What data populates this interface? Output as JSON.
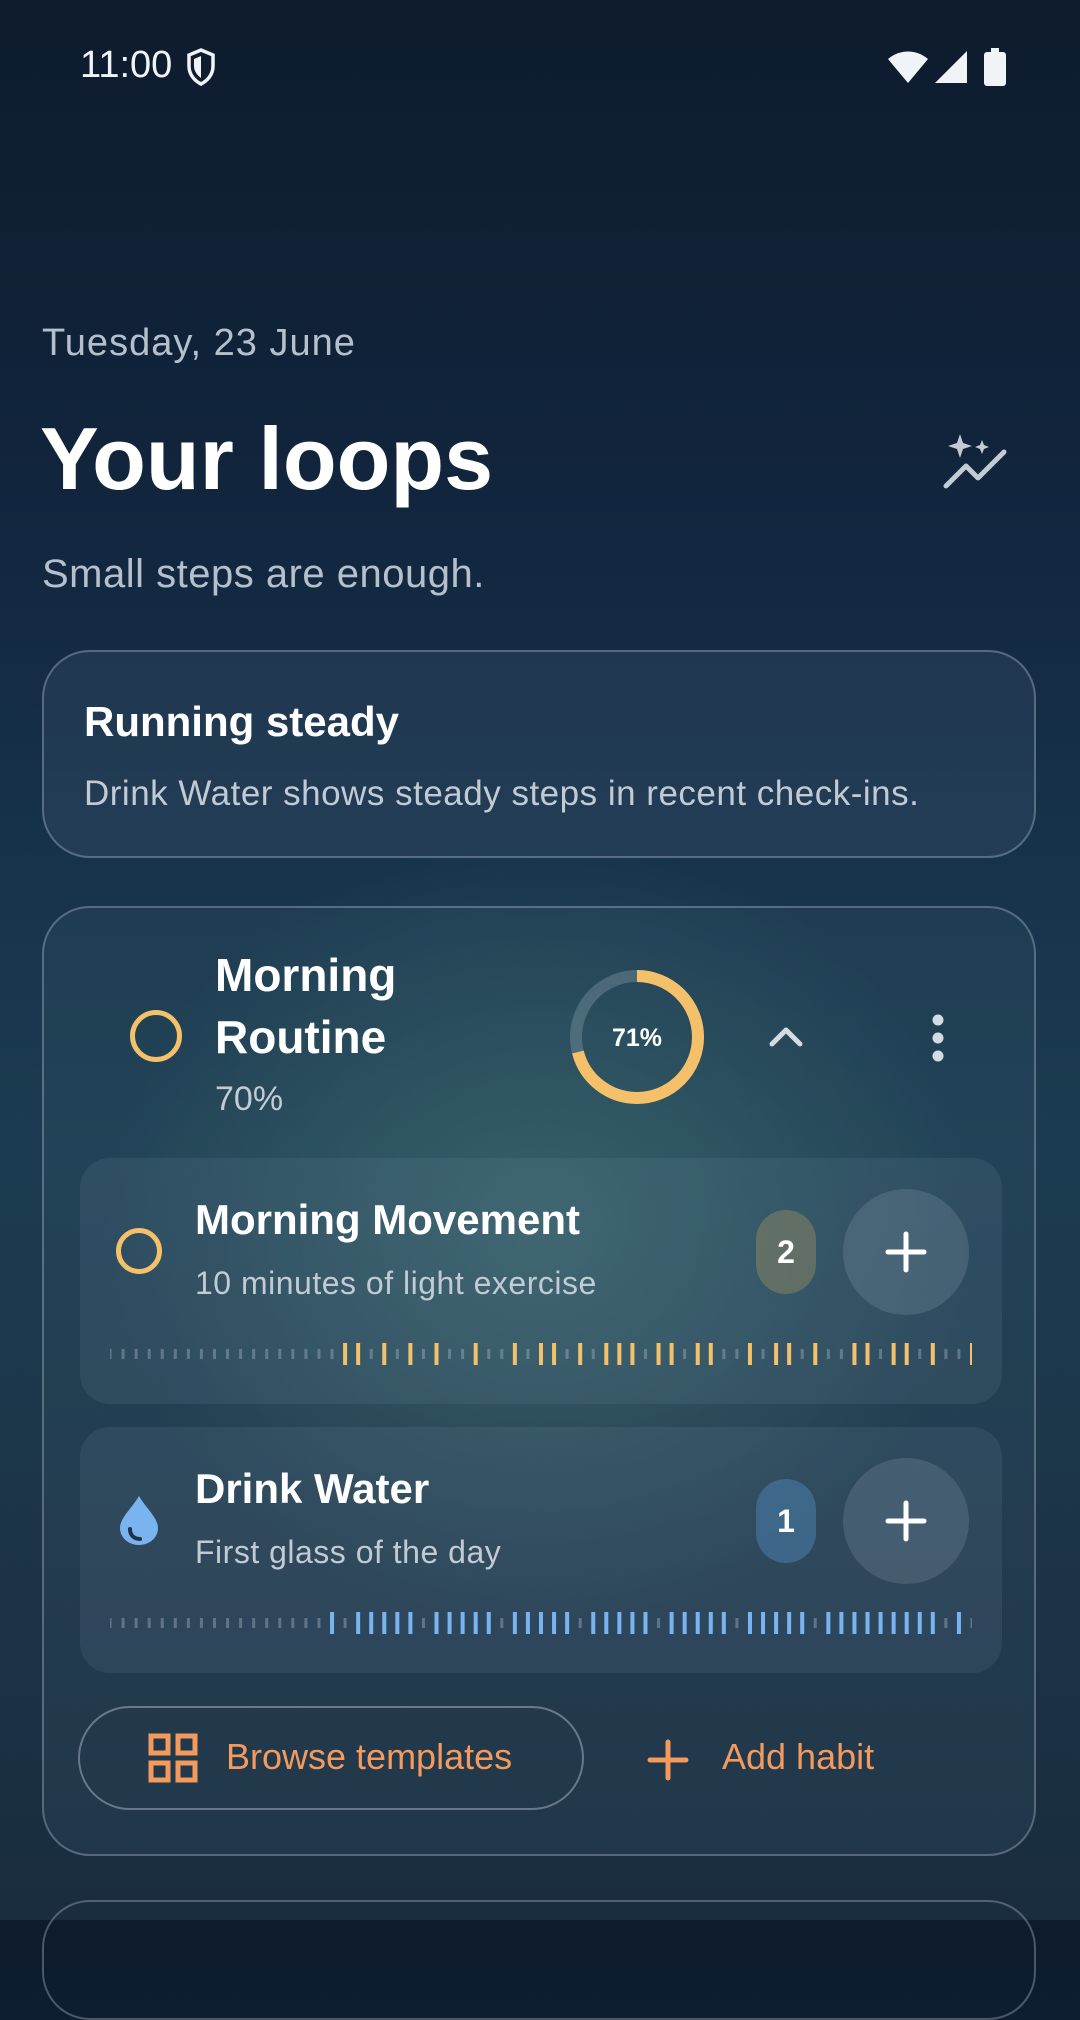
{
  "status_bar": {
    "time": "11:00"
  },
  "header": {
    "date": "Tuesday, 23 June",
    "title": "Your loops",
    "subtitle": "Small steps are enough."
  },
  "banner": {
    "title": "Running steady",
    "description": "Drink Water shows steady steps in recent check-ins."
  },
  "group": {
    "name": "Morning Routine",
    "percent_label": "70%",
    "progress_label": "71%",
    "progress": 0.71,
    "accent": "#f4c06a"
  },
  "habits": [
    {
      "name": "Morning Movement",
      "description": "10 minutes of light exercise",
      "count": "2",
      "color": "#f4c06a",
      "icon": "ring-icon",
      "history": [
        0,
        0,
        0,
        0,
        0,
        0,
        0,
        0,
        0,
        0,
        0,
        0,
        0,
        0,
        0,
        0,
        0,
        0,
        1,
        1,
        0,
        1,
        0,
        1,
        0,
        1,
        0,
        0,
        1,
        0,
        0,
        1,
        0,
        1,
        1,
        0,
        1,
        0,
        1,
        1,
        1,
        0,
        1,
        1,
        0,
        1,
        1,
        0,
        0,
        1,
        0,
        1,
        1,
        0,
        1,
        0,
        0,
        1,
        1,
        0,
        1,
        1,
        0,
        1,
        0,
        0,
        1
      ]
    },
    {
      "name": "Drink Water",
      "description": "First glass of the day",
      "count": "1",
      "color": "#7ab4f0",
      "icon": "water-drop-icon",
      "history": [
        0,
        0,
        0,
        0,
        0,
        0,
        0,
        0,
        0,
        0,
        0,
        0,
        0,
        0,
        0,
        0,
        0,
        1,
        0,
        1,
        1,
        1,
        1,
        1,
        0,
        1,
        1,
        1,
        1,
        1,
        0,
        1,
        1,
        1,
        1,
        1,
        0,
        1,
        1,
        1,
        1,
        1,
        0,
        1,
        1,
        1,
        1,
        1,
        0,
        1,
        1,
        1,
        1,
        1,
        0,
        1,
        1,
        1,
        1,
        1,
        1,
        1,
        1,
        1,
        0,
        1,
        0
      ]
    }
  ],
  "actions": {
    "browse_label": "Browse templates",
    "add_label": "Add habit"
  }
}
